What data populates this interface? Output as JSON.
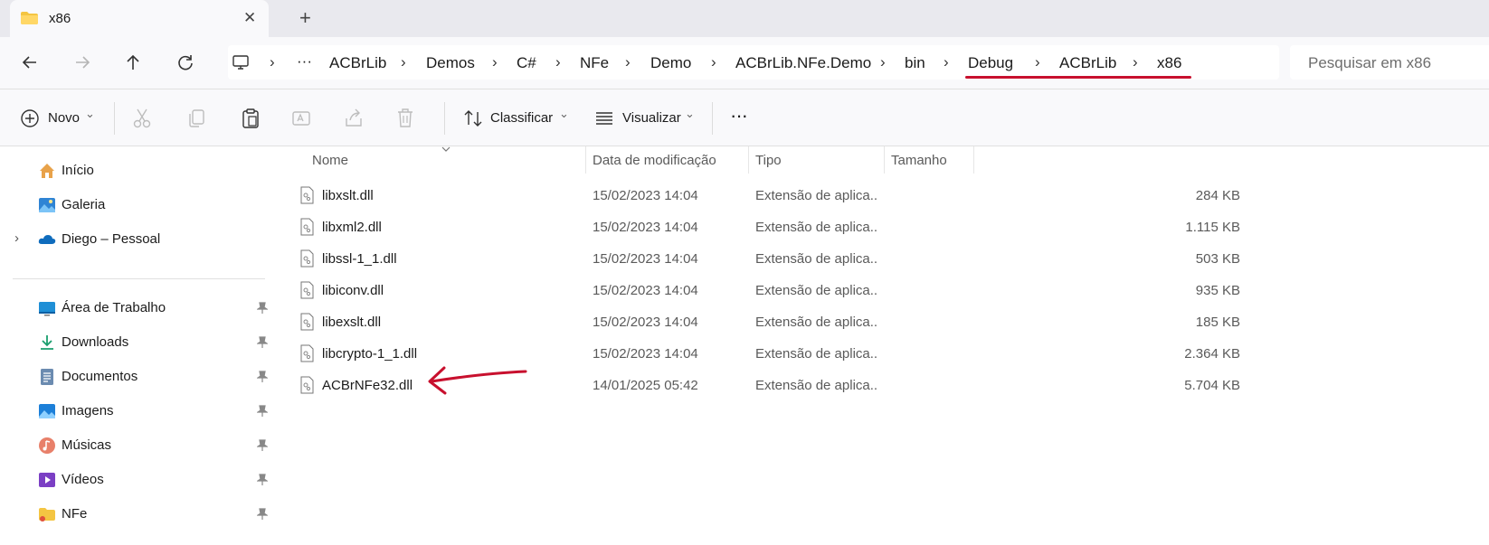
{
  "window": {
    "tab_title": "x86",
    "close_glyph": "✕",
    "new_tab_glyph": "+"
  },
  "nav": {
    "breadcrumbs": [
      "ACBrLib",
      "Demos",
      "C#",
      "NFe",
      "Demo",
      "ACBrLib.NFe.Demo",
      "bin",
      "Debug",
      "ACBrLib",
      "x86"
    ],
    "overflow_glyph": "···",
    "separator": "›",
    "search_placeholder": "Pesquisar em x86"
  },
  "toolbar": {
    "new_label": "Novo",
    "sort_label": "Classificar",
    "view_label": "Visualizar",
    "more_glyph": "···",
    "dropdown_glyph": "⌄"
  },
  "sidebar": {
    "top_items": [
      {
        "label": "Início",
        "icon": "home-icon"
      },
      {
        "label": "Galeria",
        "icon": "gallery-icon"
      },
      {
        "label": "Diego – Pessoal",
        "icon": "onedrive-cloud-icon"
      }
    ],
    "pinned_items": [
      {
        "label": "Área de Trabalho",
        "icon": "desktop-icon"
      },
      {
        "label": "Downloads",
        "icon": "downloads-icon"
      },
      {
        "label": "Documentos",
        "icon": "documents-icon"
      },
      {
        "label": "Imagens",
        "icon": "pictures-icon"
      },
      {
        "label": "Músicas",
        "icon": "music-icon"
      },
      {
        "label": "Vídeos",
        "icon": "videos-icon"
      },
      {
        "label": "NFe",
        "icon": "folder-icon"
      }
    ]
  },
  "columns": {
    "name": "Nome",
    "date": "Data de modificação",
    "type": "Tipo",
    "size": "Tamanho"
  },
  "files": [
    {
      "name": "libxslt.dll",
      "date": "15/02/2023 14:04",
      "type": "Extensão de aplica...",
      "size": "284 KB"
    },
    {
      "name": "libxml2.dll",
      "date": "15/02/2023 14:04",
      "type": "Extensão de aplica...",
      "size": "1.115 KB"
    },
    {
      "name": "libssl-1_1.dll",
      "date": "15/02/2023 14:04",
      "type": "Extensão de aplica...",
      "size": "503 KB"
    },
    {
      "name": "libiconv.dll",
      "date": "15/02/2023 14:04",
      "type": "Extensão de aplica...",
      "size": "935 KB"
    },
    {
      "name": "libexslt.dll",
      "date": "15/02/2023 14:04",
      "type": "Extensão de aplica...",
      "size": "185 KB"
    },
    {
      "name": "libcrypto-1_1.dll",
      "date": "15/02/2023 14:04",
      "type": "Extensão de aplica...",
      "size": "2.364 KB"
    },
    {
      "name": "ACBrNFe32.dll",
      "date": "14/01/2025 05:42",
      "type": "Extensão de aplica...",
      "size": "5.704 KB"
    }
  ],
  "colors": {
    "annotation_red": "#c8102e",
    "folder_yellow": "#f4c542",
    "accent_blue": "#0067c0"
  }
}
